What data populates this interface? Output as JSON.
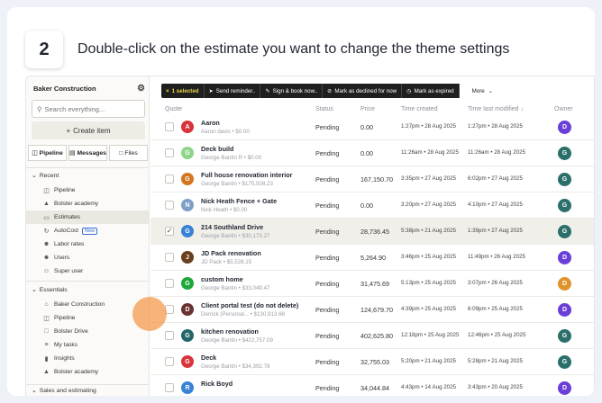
{
  "step": {
    "number": "2",
    "instruction": "Double-click on the estimate you want to change the theme settings"
  },
  "sidebar": {
    "company": "Baker Construction",
    "search_placeholder": "Search everything...",
    "create_label": "Create item",
    "quick_links": [
      {
        "label": "Pipeline",
        "icon": "columns-icon"
      },
      {
        "label": "Messages",
        "icon": "messages-icon"
      },
      {
        "label": "Files",
        "icon": "folder-icon"
      }
    ],
    "recent_heading": "Recent",
    "recent": [
      {
        "label": "Pipeline",
        "icon": "columns-icon"
      },
      {
        "label": "Bolster academy",
        "icon": "graduation-cap-icon"
      },
      {
        "label": "Estimates",
        "icon": "document-icon"
      },
      {
        "label": "AutoCost",
        "icon": "autocost-icon",
        "badge": "New"
      },
      {
        "label": "Labor rates",
        "icon": "worker-icon"
      },
      {
        "label": "Users",
        "icon": "users-icon"
      },
      {
        "label": "Super user",
        "icon": "super-user-icon"
      }
    ],
    "essentials_heading": "Essentials",
    "essentials": [
      {
        "label": "Baker Construction",
        "icon": "home-icon"
      },
      {
        "label": "Pipeline",
        "icon": "columns-icon"
      },
      {
        "label": "Bolster Drive",
        "icon": "folder-icon"
      },
      {
        "label": "My tasks",
        "icon": "tasks-icon"
      },
      {
        "label": "Insights",
        "icon": "chart-icon"
      },
      {
        "label": "Bolster academy",
        "icon": "graduation-cap-icon"
      }
    ],
    "sales_heading": "Sales and estimating"
  },
  "toolbar": {
    "selected": "1 selected",
    "send_reminder": "Send reminder..",
    "sign_book": "Sign & book now..",
    "mark_declined": "Mark as declined for now",
    "mark_expired": "Mark as expired",
    "more": "More"
  },
  "table": {
    "columns": {
      "quote": "Quote",
      "status": "Status",
      "price": "Price",
      "created": "Time created",
      "modified": "Time last modified ↓",
      "owner": "Owner"
    },
    "rows": [
      {
        "initial": "A",
        "color": "#d8343d",
        "name": "Aaron",
        "sub": "Aaron davis • $0.00",
        "status": "Pending",
        "price": "0.00",
        "created": "1:27pm • 28 Aug 2025",
        "modified": "1:27pm • 28 Aug 2025",
        "owner": "D",
        "owner_color": "#6a3fd6",
        "checked": false
      },
      {
        "initial": "G",
        "color": "#8ed48a",
        "name": "Deck build",
        "sub": "George Bantin R • $0.00",
        "status": "Pending",
        "price": "0.00",
        "created": "11:26am • 28 Aug 2025",
        "modified": "11:26am • 28 Aug 2025",
        "owner": "G",
        "owner_color": "#2a6f6a",
        "checked": false
      },
      {
        "initial": "G",
        "color": "#d2761f",
        "name": "Full house renovation interior",
        "sub": "George Bantin • $175,508.23",
        "status": "Pending",
        "price": "167,150.70",
        "created": "3:35pm • 27 Aug 2025",
        "modified": "6:02pm • 27 Aug 2025",
        "owner": "G",
        "owner_color": "#2a6f6a",
        "checked": false
      },
      {
        "initial": "N",
        "color": "#7f9fc8",
        "name": "Nick Heath Fence + Gate",
        "sub": "Nick Heath • $0.00",
        "status": "Pending",
        "price": "0.00",
        "created": "3:20pm • 27 Aug 2025",
        "modified": "4:10pm • 27 Aug 2025",
        "owner": "G",
        "owner_color": "#2a6f6a",
        "checked": false
      },
      {
        "initial": "G",
        "color": "#3a82d6",
        "name": "214 Southland Drive",
        "sub": "George Bantin • $30,173.27",
        "status": "Pending",
        "price": "28,736.45",
        "created": "5:38pm • 21 Aug 2025",
        "modified": "1:39pm • 27 Aug 2025",
        "owner": "G",
        "owner_color": "#2a6f6a",
        "checked": true
      },
      {
        "initial": "J",
        "color": "#6a3f1c",
        "name": "JD Pack renovation",
        "sub": "JD Pack • $5,528.15",
        "status": "Pending",
        "price": "5,264.90",
        "created": "3:46pm • 25 Aug 2025",
        "modified": "11:49pm • 26 Aug 2025",
        "owner": "D",
        "owner_color": "#6a3fd6",
        "checked": false
      },
      {
        "initial": "G",
        "color": "#1fa83a",
        "name": "custom home",
        "sub": "George Bantin • $33,049.47",
        "status": "Pending",
        "price": "31,475.69",
        "created": "5:13pm • 25 Aug 2025",
        "modified": "3:07pm • 26 Aug 2025",
        "owner": "D",
        "owner_color": "#e0932c",
        "checked": false
      },
      {
        "initial": "D",
        "color": "#6b3232",
        "name": "Client portal test (do not delete)",
        "sub": "Derrick (Personal... • $130,913.68",
        "status": "Pending",
        "price": "124,679.70",
        "created": "4:39pm • 25 Aug 2025",
        "modified": "6:09pm • 25 Aug 2025",
        "owner": "D",
        "owner_color": "#6a3fd6",
        "checked": false
      },
      {
        "initial": "G",
        "color": "#23666a",
        "name": "kitchen renovation",
        "sub": "George Bantin • $422,757.09",
        "status": "Pending",
        "price": "402,625.80",
        "created": "12:18pm • 25 Aug 2025",
        "modified": "12:46pm • 25 Aug 2025",
        "owner": "G",
        "owner_color": "#2a6f6a",
        "checked": false
      },
      {
        "initial": "G",
        "color": "#d8343d",
        "name": "Deck",
        "sub": "George Bantin • $34,392.78",
        "status": "Pending",
        "price": "32,755.03",
        "created": "5:20pm • 21 Aug 2025",
        "modified": "5:28pm • 21 Aug 2025",
        "owner": "G",
        "owner_color": "#2a6f6a",
        "checked": false
      },
      {
        "initial": "R",
        "color": "#3a82d6",
        "name": "Rick Boyd",
        "sub": "",
        "status": "Pending",
        "price": "34,044.84",
        "created": "4:43pm • 14 Aug 2025",
        "modified": "3:43pm • 20 Aug 2025",
        "owner": "D",
        "owner_color": "#6a3fd6",
        "checked": false
      }
    ]
  }
}
